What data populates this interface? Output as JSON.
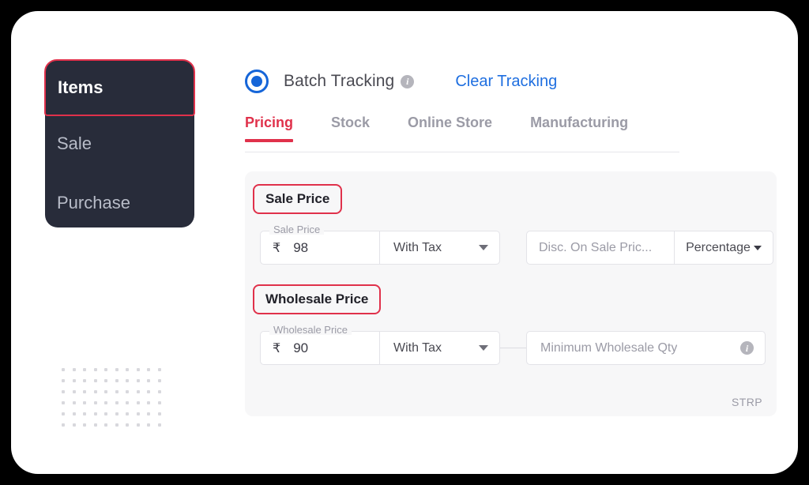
{
  "sidebar": {
    "items": [
      {
        "label": "Items",
        "active": true
      },
      {
        "label": "Sale",
        "active": false
      },
      {
        "label": "Purchase",
        "active": false
      }
    ]
  },
  "header": {
    "radio_label": "Batch Tracking",
    "radio_selected": true,
    "info_icon": "info-icon",
    "clear_link": "Clear Tracking",
    "accent_blue": "#1f6fe0"
  },
  "tabs": [
    {
      "label": "Pricing",
      "active": true
    },
    {
      "label": "Stock",
      "active": false
    },
    {
      "label": "Online Store",
      "active": false
    },
    {
      "label": "Manufacturing",
      "active": false
    }
  ],
  "panel": {
    "accent_red": "#e0314b",
    "sale": {
      "section_title": "Sale Price",
      "price_label": "Sale Price",
      "currency": "₹",
      "price_value": "98",
      "tax_option": "With Tax",
      "discount_placeholder": "Disc. On Sale Pric...",
      "discount_type": "Percentage"
    },
    "wholesale": {
      "section_title": "Wholesale Price",
      "price_label": "Wholesale Price",
      "currency": "₹",
      "price_value": "90",
      "tax_option": "With Tax",
      "min_qty_placeholder": "Minimum Wholesale Qty",
      "min_qty_info_icon": "info-icon"
    },
    "footer_note": "STRP"
  }
}
